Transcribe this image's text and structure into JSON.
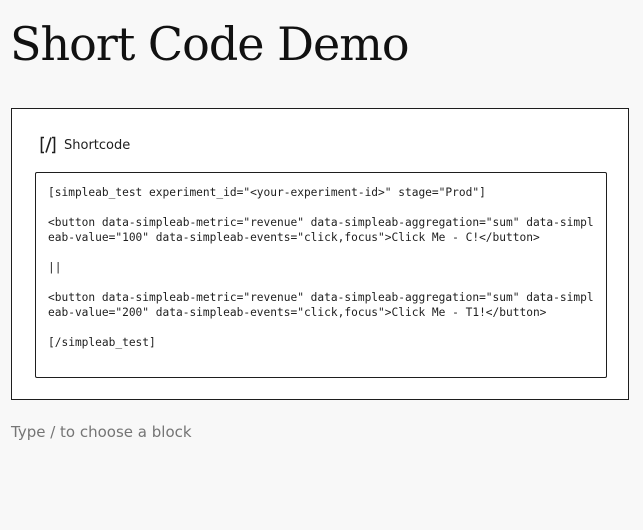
{
  "page": {
    "title": "Short Code Demo"
  },
  "shortcode_block": {
    "icon": "shortcode-icon",
    "label": "Shortcode",
    "lines": [
      "[simpleab_test experiment_id=\"<your-experiment-id>\" stage=\"Prod\"]",
      "<button data-simpleab-metric=\"revenue\" data-simpleab-aggregation=\"sum\" data-simpleab-value=\"100\" data-simpleab-events=\"click,focus\">Click Me - C!</button>",
      "||",
      "<button data-simpleab-metric=\"revenue\" data-simpleab-aggregation=\"sum\" data-simpleab-value=\"200\" data-simpleab-events=\"click,focus\">Click Me - T1!</button>",
      "[/simpleab_test]"
    ]
  },
  "appender": {
    "placeholder": "Type / to choose a block"
  },
  "colors": {
    "background": "#f8f8f8",
    "border": "#1e1e1e",
    "placeholder_text": "#757575"
  }
}
